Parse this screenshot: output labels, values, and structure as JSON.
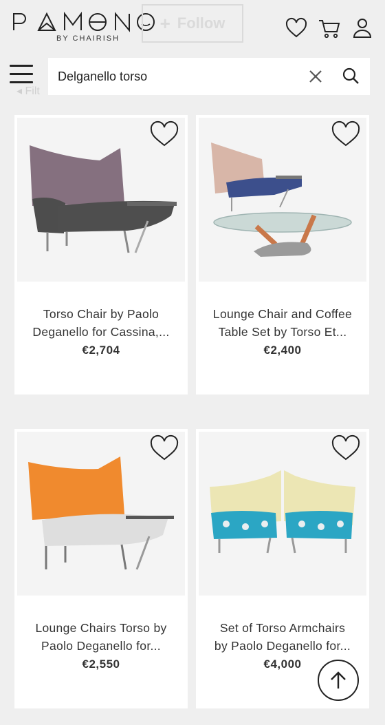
{
  "header": {
    "logo_text": "PAMONO",
    "logo_sub": "BY CHAIRISH",
    "follow_label": "Follow",
    "icons": [
      "heart-icon",
      "cart-icon",
      "user-icon"
    ]
  },
  "search": {
    "value": "Delganello torso",
    "filter_label": "Filt"
  },
  "products": [
    {
      "title_1": "Torso Chair by Paolo",
      "title_2": "Deganello for Cassina,...",
      "price": "€2,704"
    },
    {
      "title_1": "Lounge Chair and Coffee",
      "title_2": "Table Set by Torso Et...",
      "price": "€2,400"
    },
    {
      "title_1": "Lounge Chairs Torso by",
      "title_2": "Paolo Deganello for...",
      "price": "€2,550"
    },
    {
      "title_1": "Set of Torso Armchairs",
      "title_2": "by Paolo Deganello for...",
      "price": "€4,000"
    }
  ],
  "colors": {
    "background": "#efefef",
    "card": "#ffffff",
    "text": "#333333"
  }
}
